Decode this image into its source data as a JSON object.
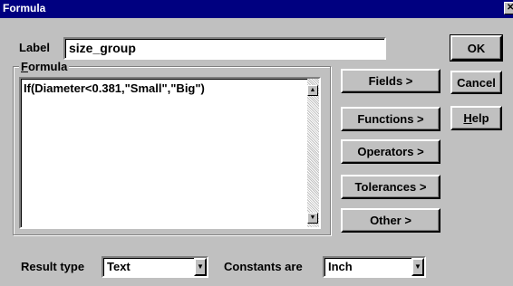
{
  "window": {
    "title": "Formula",
    "close_glyph": "✕"
  },
  "label_field": {
    "label": "Label",
    "value": "size_group"
  },
  "formula_group": {
    "legend_first": "F",
    "legend_rest": "ormula",
    "text": "If(Diameter<0.381,\"Small\",\"Big\")"
  },
  "buttons": {
    "ok": "OK",
    "cancel": "Cancel",
    "help_first": "H",
    "help_rest": "elp",
    "fields": "Fields >",
    "functions": "Functions >",
    "operators": "Operators >",
    "tolerances": "Tolerances >",
    "other": "Other >"
  },
  "result_type": {
    "label": "Result type",
    "value": "Text"
  },
  "constants": {
    "label": "Constants are",
    "value": "Inch"
  },
  "icons": {
    "scroll_up": "▲",
    "scroll_down": "▼",
    "combo_arrow": "▼"
  }
}
